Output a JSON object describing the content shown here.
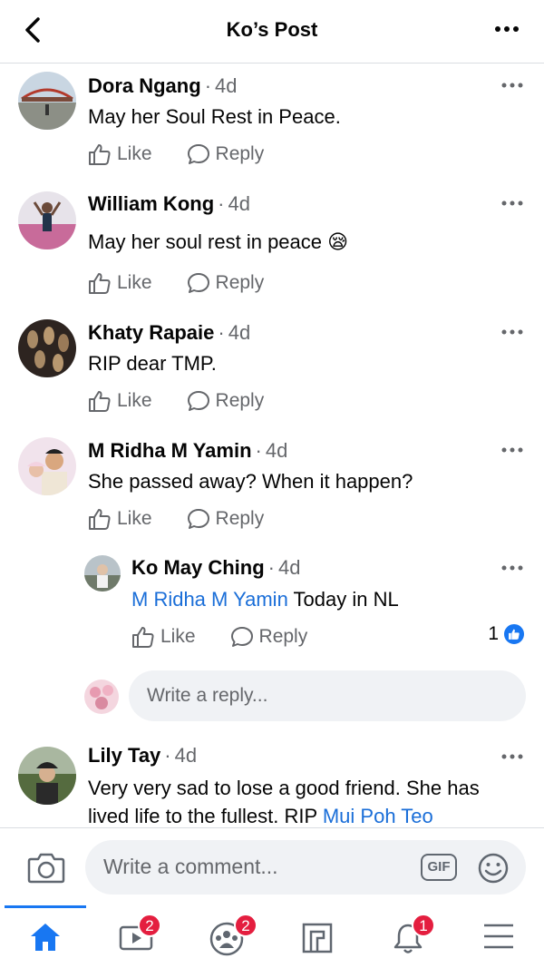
{
  "header": {
    "title": "Ko’s Post"
  },
  "actions": {
    "like": "Like",
    "reply": "Reply"
  },
  "comments": [
    {
      "name": "Dora Ngang",
      "sep": "·",
      "time": "4d",
      "text": "May her Soul Rest in Peace."
    },
    {
      "name": "William Kong",
      "sep": "·",
      "time": "4d",
      "text": "May her soul rest in peace",
      "emoji": "😪"
    },
    {
      "name": "Khaty Rapaie",
      "sep": "·",
      "time": "4d",
      "text": "RIP dear TMP."
    },
    {
      "name": "M Ridha M Yamin",
      "sep": "·",
      "time": "4d",
      "text": "She passed away? When it happen?"
    }
  ],
  "reply": {
    "name": "Ko May Ching",
    "sep": "·",
    "time": "4d",
    "mention": "M Ridha M Yamin",
    "text": " Today in NL",
    "reaction_count": "1"
  },
  "reply_box": {
    "placeholder": "Write a reply..."
  },
  "last_comment": {
    "name": "Lily Tay",
    "sep": "·",
    "time": "4d",
    "line1": "Very very sad to lose a good friend. She has",
    "line2": "lived life to the fullest. RIP ",
    "mention": "Mui Poh Teo"
  },
  "composer": {
    "placeholder": "Write a comment...",
    "gif": "GIF"
  },
  "tabbar": {
    "tabs": [
      {
        "icon": "home-icon",
        "badge": ""
      },
      {
        "icon": "watch-icon",
        "badge": "2"
      },
      {
        "icon": "groups-icon",
        "badge": "2"
      },
      {
        "icon": "pages-icon",
        "badge": ""
      },
      {
        "icon": "bell-icon",
        "badge": "1"
      },
      {
        "icon": "menu-icon",
        "badge": ""
      }
    ]
  },
  "colors": {
    "accent": "#1877f2",
    "mention": "#1a6ed8",
    "secondary": "#65676b",
    "badge": "#e41e3f"
  }
}
